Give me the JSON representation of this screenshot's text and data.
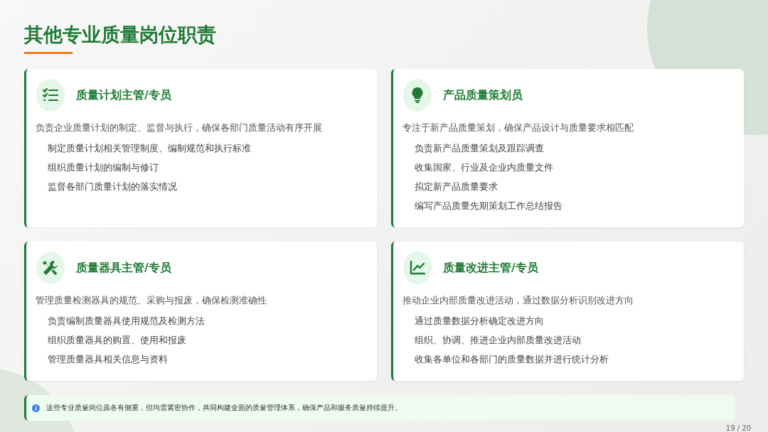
{
  "title": "其他专业质量岗位职责",
  "cards": [
    {
      "kind": "checklist",
      "title": "质量计划主管/专员",
      "summary": "负责企业质量计划的制定、监督与执行，确保各部门质量活动有序开展",
      "items": [
        "制定质量计划相关管理制度、编制规范和执行标准",
        "组织质量计划的编制与修订",
        "监督各部门质量计划的落实情况"
      ]
    },
    {
      "kind": "bulb",
      "title": "产品质量策划员",
      "summary": "专注于新产品质量策划，确保产品设计与质量要求相匹配",
      "items": [
        "负责新产品质量策划及跟踪调查",
        "收集国家、行业及企业内质量文件",
        "拟定新产品质量要求",
        "编写产品质量先期策划工作总结报告"
      ]
    },
    {
      "kind": "tools",
      "title": "质量器具主管/专员",
      "summary": "管理质量检测器具的规范、采购与报废，确保检测准确性",
      "items": [
        "负责编制质量器具使用规范及检测方法",
        "组织质量器具的购置、使用和报废",
        "管理质量器具相关信息与资料"
      ]
    },
    {
      "kind": "chart",
      "title": "质量改进主管/专员",
      "summary": "推动企业内部质量改进活动，通过数据分析识别改进方向",
      "items": [
        "通过质量数据分析确定改进方向",
        "组织、协调、推进企业内部质量改进活动",
        "收集各单位和各部门的质量数据并进行统计分析"
      ]
    }
  ],
  "note": "这些专业质量岗位虽各有侧重，但均需紧密协作，共同构建全面的质量管理体系，确保产品和服务质量持续提升。",
  "page": "19 / 20"
}
